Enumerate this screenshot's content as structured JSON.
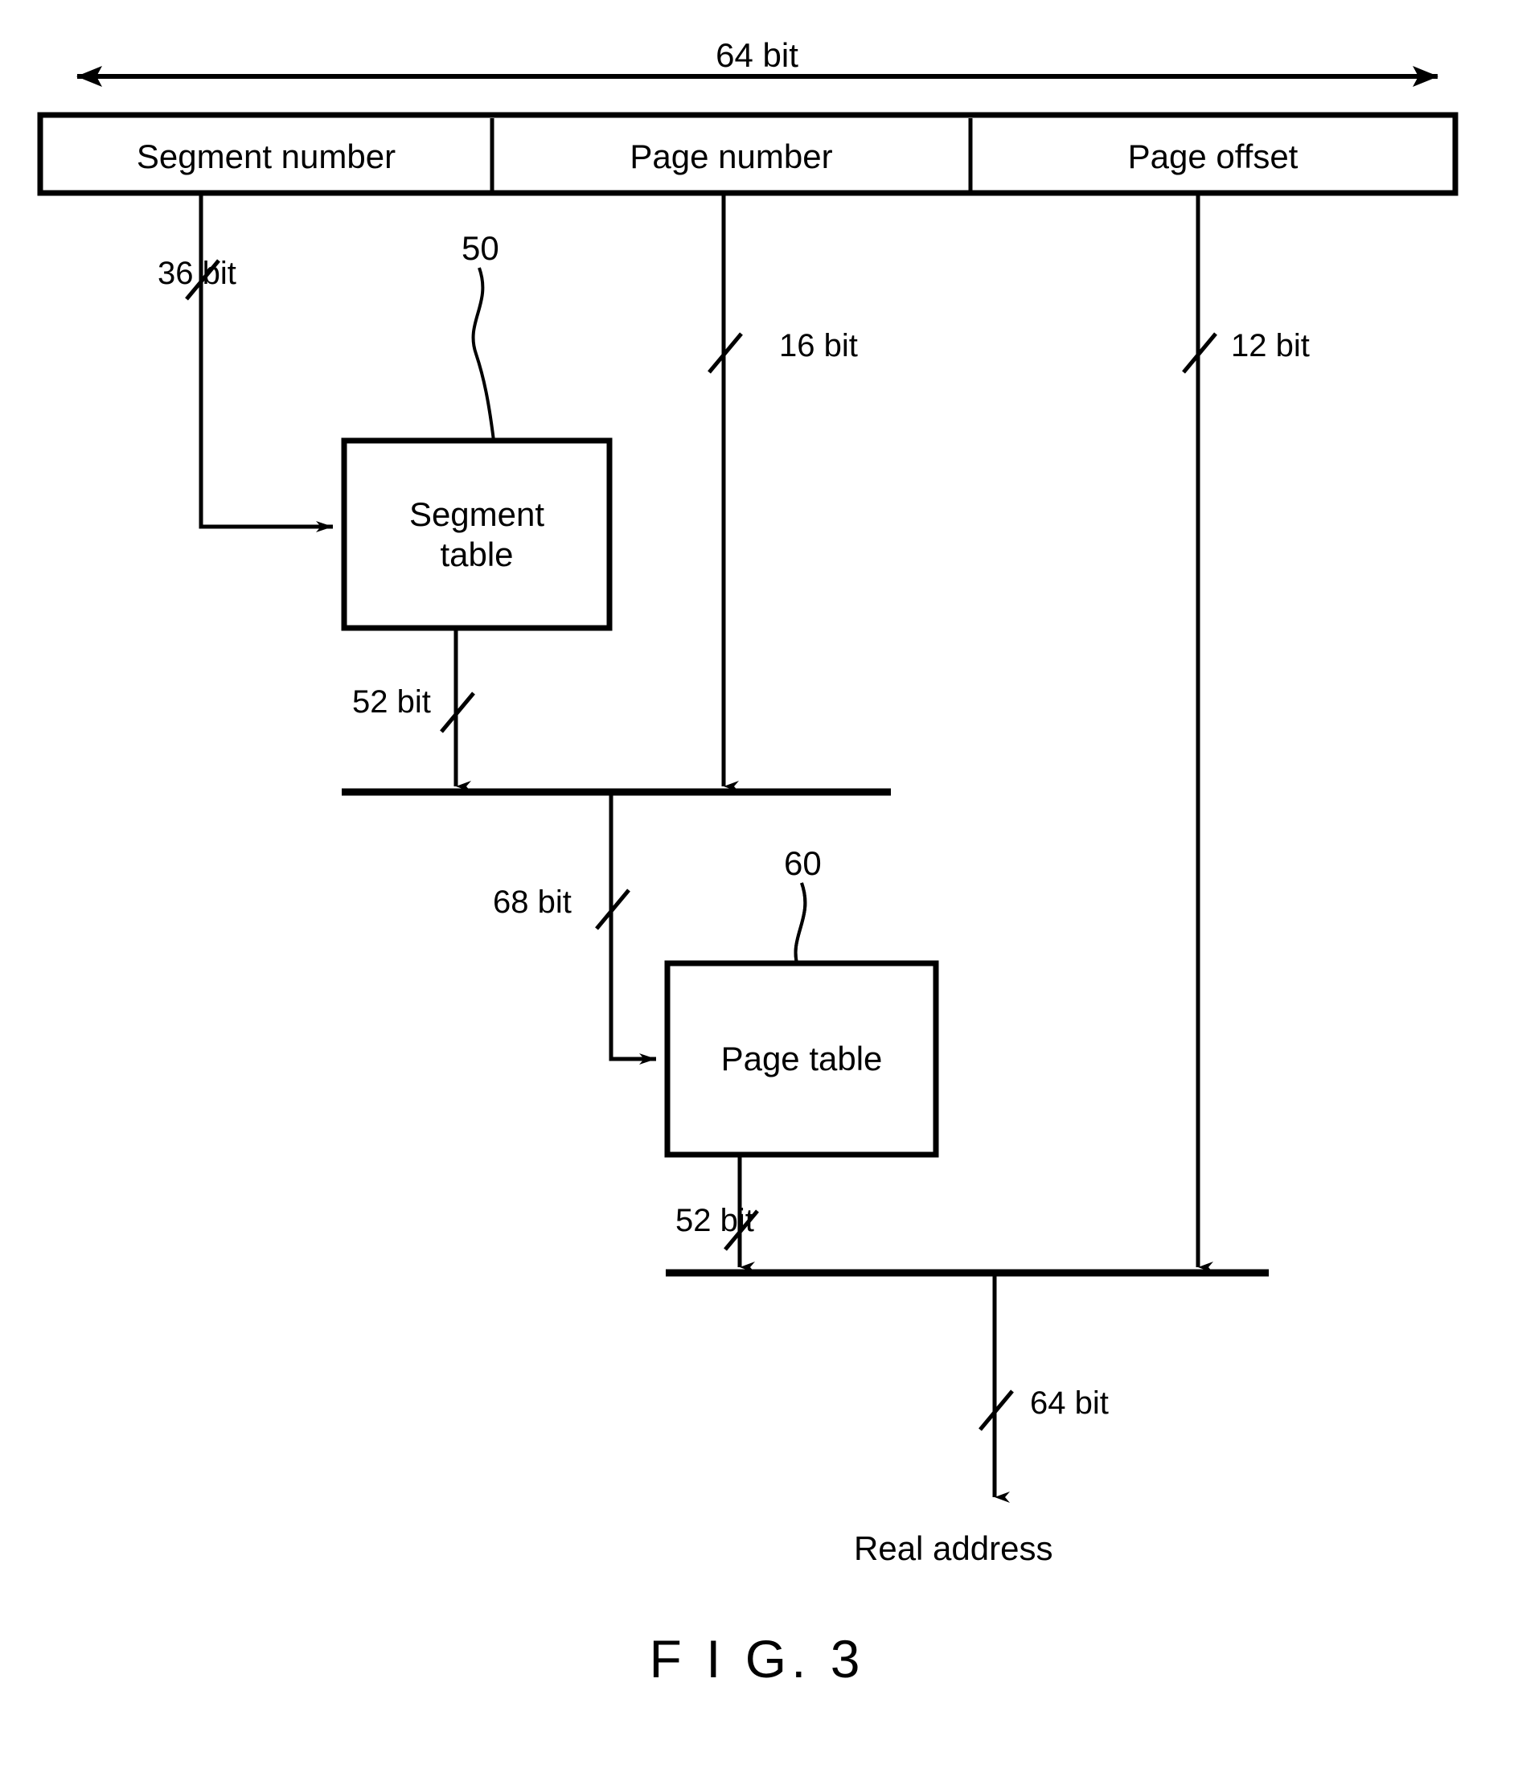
{
  "figure": {
    "caption": "F I G. 3",
    "total_width_label": "64 bit"
  },
  "address_format": {
    "total_bits": "64 bit",
    "fields": [
      {
        "label": "Segment number",
        "bits": "36 bit"
      },
      {
        "label": "Page number",
        "bits": "16 bit"
      },
      {
        "label": "Page offset",
        "bits": "12 bit"
      }
    ]
  },
  "blocks": [
    {
      "ref": "50",
      "label": "Segment\ntable",
      "label_line1": "Segment",
      "label_line2": "table",
      "output_bits": "52 bit"
    },
    {
      "ref": "60",
      "label": "Page table",
      "label_line1": "Page  table",
      "label_line2": "",
      "output_bits": "52 bit"
    }
  ],
  "signals": {
    "segment_index_bits": "36 bit",
    "page_index_bits": "16 bit",
    "page_offset_bits": "12 bit",
    "segment_table_out_bits": "52 bit",
    "page_table_lookup_bits": "68 bit",
    "page_table_out_bits": "52 bit",
    "real_address_bits": "64 bit"
  },
  "output": {
    "label": "Real  address"
  },
  "colors": {
    "stroke": "#000000",
    "background": "#ffffff"
  }
}
